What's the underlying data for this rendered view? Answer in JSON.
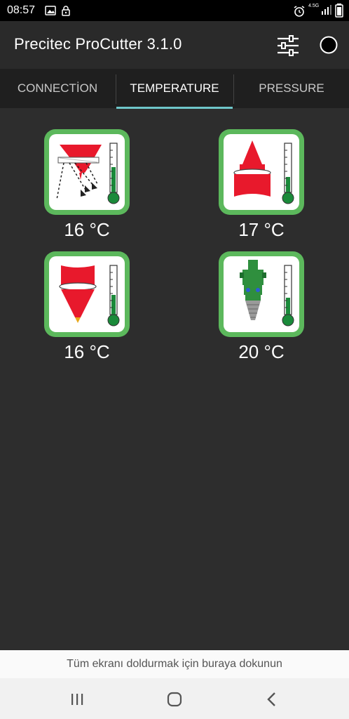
{
  "status_bar": {
    "time": "08:57",
    "network": "4.5G",
    "icons": [
      "image-icon",
      "lock-icon",
      "alarm-icon",
      "signal-icon",
      "battery-icon"
    ]
  },
  "app_bar": {
    "title": "Precitec ProCutter 3.1.0",
    "icons": [
      "settings-sliders-icon",
      "connection-status-circle-icon"
    ]
  },
  "tabs": [
    {
      "label": "CONNECTİON",
      "active": false
    },
    {
      "label": "TEMPERATURE",
      "active": true
    },
    {
      "label": "PRESSURE",
      "active": false
    }
  ],
  "sensors": [
    {
      "icon": "protective-glass-beam-icon",
      "temperature": "16 °C"
    },
    {
      "icon": "nozzle-cone-icon",
      "temperature": "17 °C"
    },
    {
      "icon": "focus-lens-cone-icon",
      "temperature": "16 °C"
    },
    {
      "icon": "cutting-head-icon",
      "temperature": "20 °C"
    }
  ],
  "toast": "Tüm ekranı doldurmak için buraya dokunun",
  "colors": {
    "tile_border": "#5cb85c",
    "thermometer": "#1a8a3a",
    "red_part": "#e8192c",
    "tab_indicator": "#6ec6c9",
    "background": "#2d2d2d"
  }
}
